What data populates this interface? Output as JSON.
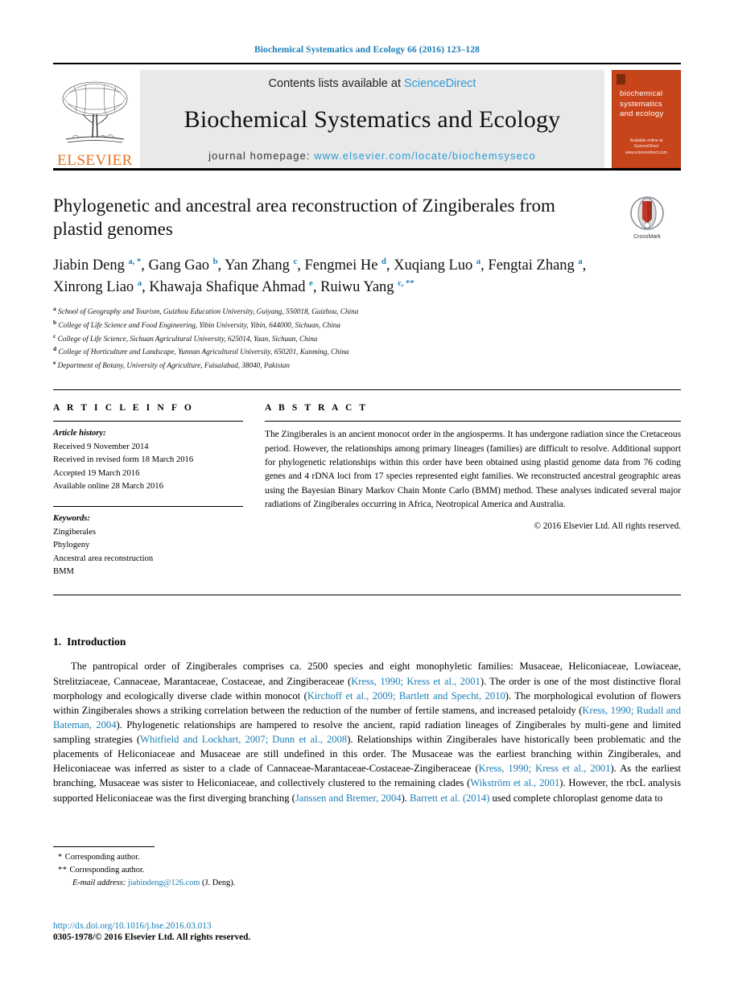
{
  "running_head": "Biochemical Systematics and Ecology 66 (2016) 123–128",
  "masthead": {
    "contents_prefix": "Contents lists available at ",
    "sciencedirect": "ScienceDirect",
    "journal_title": "Biochemical Systematics and Ecology",
    "homepage_prefix": "journal homepage: ",
    "homepage_url": "www.elsevier.com/locate/biochemsyseco",
    "publisher": "ELSEVIER",
    "cover_title": "biochemical\nsystematics\nand ecology",
    "cover_footer": "Available online at\nScienceDirect\nwww.sciencedirect.com",
    "accent_blue": "#2e9bd6",
    "cover_orange": "#C8441B",
    "elsevier_orange": "#E8721C"
  },
  "article": {
    "title": "Phylogenetic and ancestral area reconstruction of Zingiberales from plastid genomes",
    "crossmark_label": "CrossMark",
    "authors_html": "Jiabin Deng <sup>a, *</sup>, Gang Gao <sup>b</sup>, Yan Zhang <sup>c</sup>, Fengmei He <sup>d</sup>, Xuqiang Luo <sup>a</sup>, Fengtai Zhang <sup>a</sup>, Xinrong Liao <sup>a</sup>, Khawaja Shafique Ahmad <sup>e</sup>, Ruiwu Yang <sup>c, **</sup>",
    "affiliations": [
      {
        "mark": "a",
        "text": "School of Geography and Tourism, Guizhou Education University, Guiyang, 550018, Guizhou, China"
      },
      {
        "mark": "b",
        "text": "College of Life Science and Food Engineering, Yibin University, Yibin, 644000, Sichuan, China"
      },
      {
        "mark": "c",
        "text": "College of Life Science, Sichuan Agricultural University, 625014, Yaan, Sichuan, China"
      },
      {
        "mark": "d",
        "text": "College of Horticulture and Landscape, Yunnan Agricultural University, 650201, Kunming, China"
      },
      {
        "mark": "e",
        "text": "Department of Botany, University of Agriculture, Faisalabad, 38040, Pakistan"
      }
    ]
  },
  "article_info": {
    "heading": "A R T I C L E   I N F O",
    "history_label": "Article history:",
    "history": [
      "Received 9 November 2014",
      "Received in revised form 18 March 2016",
      "Accepted 19 March 2016",
      "Available online 28 March 2016"
    ],
    "keywords_label": "Keywords:",
    "keywords": [
      "Zingiberales",
      "Phylogeny",
      "Ancestral area reconstruction",
      "BMM"
    ]
  },
  "abstract": {
    "heading": "A B S T R A C T",
    "text": "The Zingiberales is an ancient monocot order in the angiosperms. It has undergone radiation since the Cretaceous period. However, the relationships among primary lineages (families) are difficult to resolve. Additional support for phylogenetic relationships within this order have been obtained using plastid genome data from 76 coding genes and 4 rDNA loci from 17 species represented eight families. We reconstructed ancestral geographic areas using the Bayesian Binary Markov Chain Monte Carlo (BMM) method. These analyses indicated several major radiations of Zingiberales occurring in Africa, Neotropical America and Australia.",
    "copyright": "© 2016 Elsevier Ltd. All rights reserved."
  },
  "introduction": {
    "number": "1.",
    "title": "Introduction",
    "paragraph_html": "The pantropical order of Zingiberales comprises ca. 2500 species and eight monophyletic families: Musaceae, Heliconiaceae, Lowiaceae, Strelitziaceae, Cannaceae, Marantaceae, Costaceae, and Zingiberaceae (<span class=\"cite\">Kress, 1990; Kress et al., 2001</span>). The order is one of the most distinctive floral morphology and ecologically diverse clade within monocot (<span class=\"cite\">Kirchoff et al., 2009; Bartlett and Specht, 2010</span>). The morphological evolution of flowers within Zingiberales shows a striking correlation between the reduction of the number of fertile stamens, and increased petaloidy (<span class=\"cite\">Kress, 1990; Rudall and Bateman, 2004</span>). Phylogenetic relationships are hampered to resolve the ancient, rapid radiation lineages of Zingiberales by multi-gene and limited sampling strategies (<span class=\"cite\">Whitfield and Lockhart, 2007; Dunn et al., 2008</span>). Relationships within Zingiberales have historically been problematic and the placements of Heliconiaceae and Musaceae are still undefined in this order. The Musaceae was the earliest branching within Zingiberales, and Heliconiaceae was inferred as sister to a clade of Cannaceae-Marantaceae-Costaceae-Zingiberaceae (<span class=\"cite\">Kress, 1990; Kress et al., 2001</span>). As the earliest branching, Musaceae was sister to Heliconiaceae, and collectively clustered to the remaining clades (<span class=\"cite\">Wikström et al., 2001</span>). However, the rbcL analysis supported Heliconiaceae was the first diverging branching (<span class=\"cite\">Janssen and Bremer, 2004</span>). <span class=\"cite\">Barrett et al. (2014)</span> used complete chloroplast genome data to"
  },
  "footnotes": {
    "corresponding_1": "Corresponding author.",
    "corresponding_2": "Corresponding author.",
    "email_label": "E-mail address:",
    "email": "jiabindeng@126.com",
    "email_owner": "(J. Deng).",
    "doi": "http://dx.doi.org/10.1016/j.bse.2016.03.013",
    "issn_line": "0305-1978/© 2016 Elsevier Ltd. All rights reserved."
  }
}
